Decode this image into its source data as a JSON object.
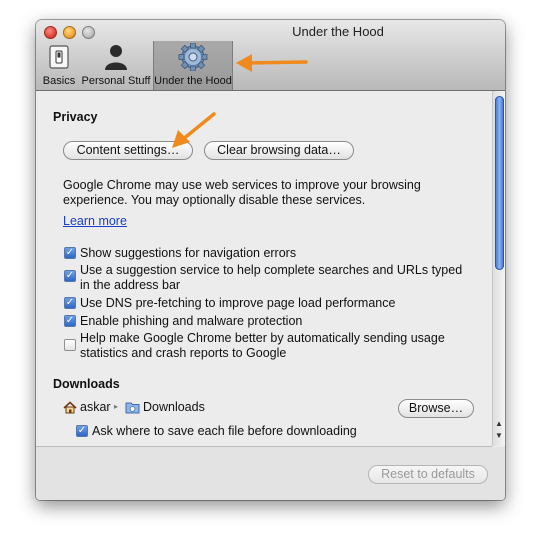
{
  "window": {
    "title": "Under the Hood"
  },
  "tabs": [
    {
      "label": "Basics",
      "icon": "switch-icon"
    },
    {
      "label": "Personal Stuff",
      "icon": "person-icon"
    },
    {
      "label": "Under the Hood",
      "icon": "gear-icon",
      "selected": true
    }
  ],
  "privacy": {
    "title": "Privacy",
    "content_settings_label": "Content settings…",
    "clear_data_label": "Clear browsing data…",
    "description_line1": "Google Chrome may use web services to improve your browsing",
    "description_line2": "experience. You may optionally disable these services.",
    "learn_more": "Learn more",
    "options": [
      {
        "line1": "Show suggestions for navigation errors",
        "checked": true
      },
      {
        "line1": "Use a suggestion service to help complete searches and URLs typed",
        "line2": "in the address bar",
        "checked": true
      },
      {
        "line1": "Use DNS pre-fetching to improve page load performance",
        "checked": true
      },
      {
        "line1": "Enable phishing and malware protection",
        "checked": true
      },
      {
        "line1": "Help make Google Chrome better by automatically sending usage",
        "line2": "statistics and crash reports to Google",
        "checked": false
      }
    ]
  },
  "downloads": {
    "title": "Downloads",
    "path_user": "askar",
    "path_folder": "Downloads",
    "browse_label": "Browse…",
    "ask_label": "Ask where to save each file before downloading",
    "ask_checked": true
  },
  "footer": {
    "reset_label": "Reset to defaults"
  },
  "colors": {
    "accent_arrow": "#f08a1c",
    "link": "#1a3fc4",
    "checkbox": "#2f66c6"
  }
}
